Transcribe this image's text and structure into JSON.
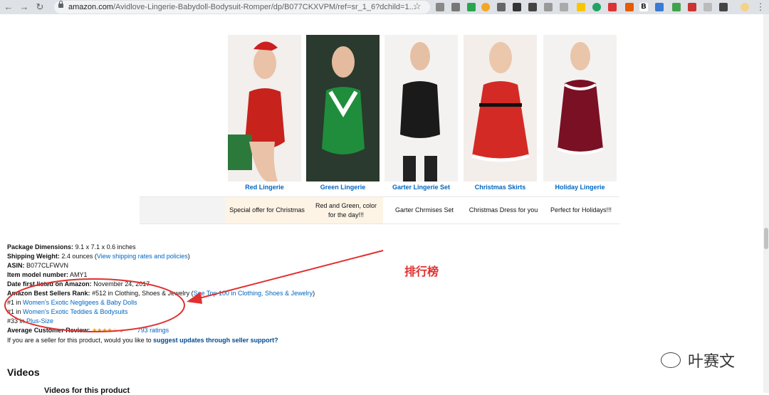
{
  "browser": {
    "url_host": "amazon.com",
    "url_path": "/Avidlove-Lingerie-Babydoll-Bodysuit-Romper/dp/B077CKXVPM/ref=sr_1_6?dchild=1..."
  },
  "comparison": {
    "products": [
      {
        "label": "Red Lingerie",
        "color": "#c8221c",
        "desc": "Special offer for Christmas"
      },
      {
        "label": "Green Lingerie",
        "color": "#1f8d3c",
        "desc": "Red and Green, color for the day!!!"
      },
      {
        "label": "Garter Lingerie Set",
        "color": "#1a1a1a",
        "desc": "Garter Chrmises Set"
      },
      {
        "label": "Christmas Skirts",
        "color": "#d42a25",
        "desc": "Christmas Dress for you"
      },
      {
        "label": "Holiday Lingerie",
        "color": "#7a1023",
        "desc": "Perfect for Holidays!!!"
      }
    ]
  },
  "details": {
    "package_dimensions_label": "Package Dimensions:",
    "package_dimensions_value": "9.1 x 7.1 x 0.6 inches",
    "shipping_weight_label": "Shipping Weight:",
    "shipping_weight_value": "2.4 ounces (",
    "shipping_link": "View shipping rates and policies",
    "shipping_close": ")",
    "asin_label": "ASIN:",
    "asin_value": "B077CLFWVN",
    "model_label": "Item model number:",
    "model_value": "AMY1",
    "date_label": "Date first listed on Amazon:",
    "date_value": "November 24, 2017",
    "rank_label": "Amazon Best Sellers Rank:",
    "rank_value": "#512 in Clothing, Shoes & Jewelry (",
    "rank_link": "See Top 100 in Clothing, Shoes & Jewelry",
    "rank_close": ")",
    "sub_ranks": [
      {
        "rank": "#1 in",
        "category": "Women's Exotic Negligees & Baby Dolls"
      },
      {
        "rank": "#1 in",
        "category": "Women's Exotic Teddies & Bodysuits"
      },
      {
        "rank": "#33 in",
        "category": "Plus-Size"
      }
    ],
    "review_label": "Average Customer Review:",
    "review_stars": "★★★★☆",
    "review_chevron": "⌄",
    "ratings_link": "793 ratings",
    "seller_text": "If you are a seller for this product, would you like to",
    "seller_link": "suggest updates through seller support?"
  },
  "videos": {
    "title": "Videos",
    "subtitle": "Videos for this product"
  },
  "annotation": {
    "text": "排行榜",
    "color": "#e03030"
  },
  "watermark": {
    "text": "叶赛文"
  }
}
